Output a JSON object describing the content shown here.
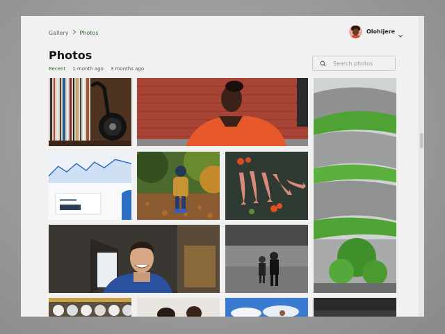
{
  "breadcrumb": {
    "root": "Gallery",
    "current": "Photos"
  },
  "user": {
    "name": "Olohijere"
  },
  "page": {
    "title": "Photos"
  },
  "filters": {
    "recent": "Recent",
    "one_month": "1 month ago",
    "three_months": "3 months ago"
  },
  "search": {
    "placeholder": "Search photos",
    "value": ""
  },
  "colors": {
    "accent": "#2f6b2f",
    "panel": "#f1f1f1"
  },
  "icons": [
    "search-icon",
    "chevron-down-icon",
    "chevron-right-icon"
  ]
}
